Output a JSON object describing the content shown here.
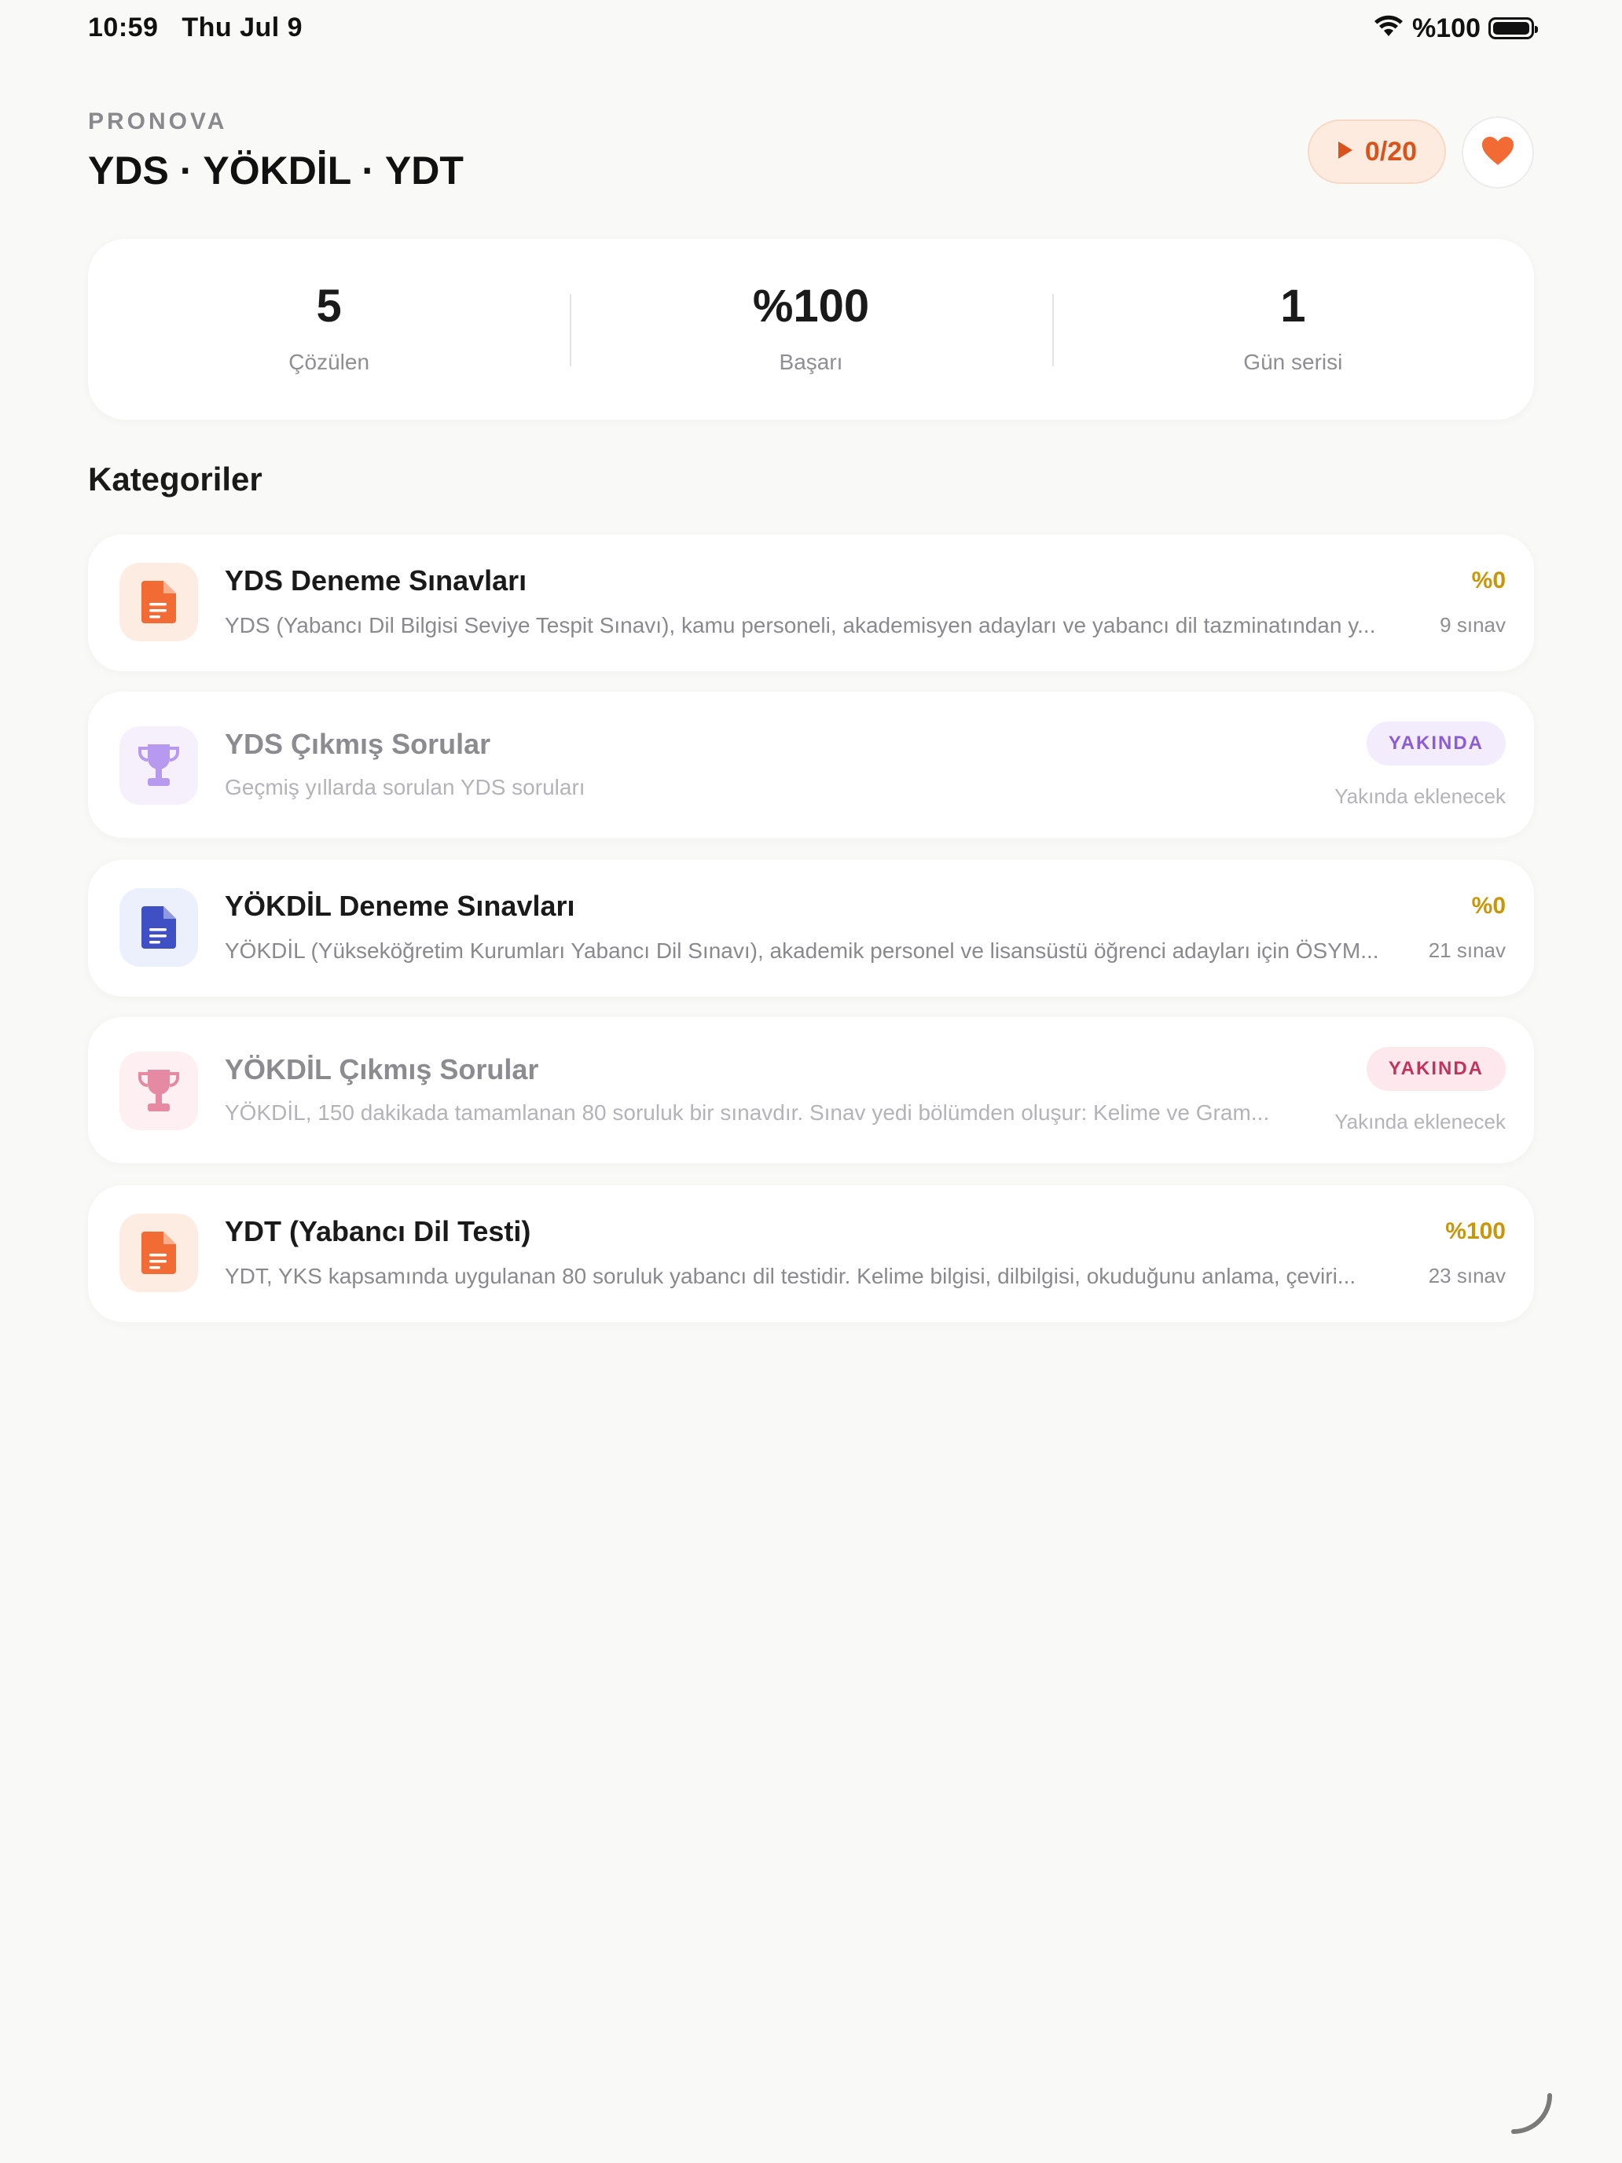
{
  "status_bar": {
    "time": "10:59",
    "date": "Thu Jul 9",
    "battery": "%100"
  },
  "header": {
    "brand": "PRONOVA",
    "title": "YDS · YÖKDİL · YDT",
    "progress": "0/20"
  },
  "stats": [
    {
      "value": "5",
      "label": "Çözülen"
    },
    {
      "value": "%100",
      "label": "Başarı"
    },
    {
      "value": "1",
      "label": "Gün serisi"
    }
  ],
  "section_title": "Kategoriler",
  "categories": [
    {
      "title": "YDS Deneme Sınavları",
      "description": "YDS (Yabancı Dil Bilgisi Seviye Tespit Sınavı), kamu personeli, akademisyen adayları ve yabancı dil tazminatından y...",
      "percent": "%0",
      "count": "9 sınav",
      "icon": "document-icon"
    },
    {
      "title": "YDS Çıkmış Sorular",
      "description": "Geçmiş yıllarda sorulan YDS soruları",
      "badge": "YAKINDA",
      "status": "Yakında eklenecek",
      "icon": "trophy-icon"
    },
    {
      "title": "YÖKDİL Deneme Sınavları",
      "description": "YÖKDİL (Yükseköğretim Kurumları Yabancı Dil Sınavı), akademik personel ve lisansüstü öğrenci adayları için ÖSYM...",
      "percent": "%0",
      "count": "21 sınav",
      "icon": "document-icon"
    },
    {
      "title": "YÖKDİL Çıkmış Sorular",
      "description": "YÖKDİL, 150 dakikada tamamlanan 80 soruluk bir sınavdır. Sınav yedi bölümden oluşur: Kelime ve Gram...",
      "badge": "YAKINDA",
      "status": "Yakında eklenecek",
      "icon": "trophy-icon"
    },
    {
      "title": "YDT (Yabancı Dil Testi)",
      "description": "YDT, YKS kapsamında uygulanan 80 soruluk yabancı dil testidir. Kelime bilgisi, dilbilgisi, okuduğunu anlama, çeviri...",
      "percent": "%100",
      "count": "23 sınav",
      "icon": "document-icon"
    }
  ],
  "colors": {
    "accent_orange": "#f26b35",
    "gold": "#c99608",
    "indigo": "#3f4fc4",
    "purple": "#b79af0",
    "pink": "#e58aa2",
    "background": "#f9f9f7"
  }
}
